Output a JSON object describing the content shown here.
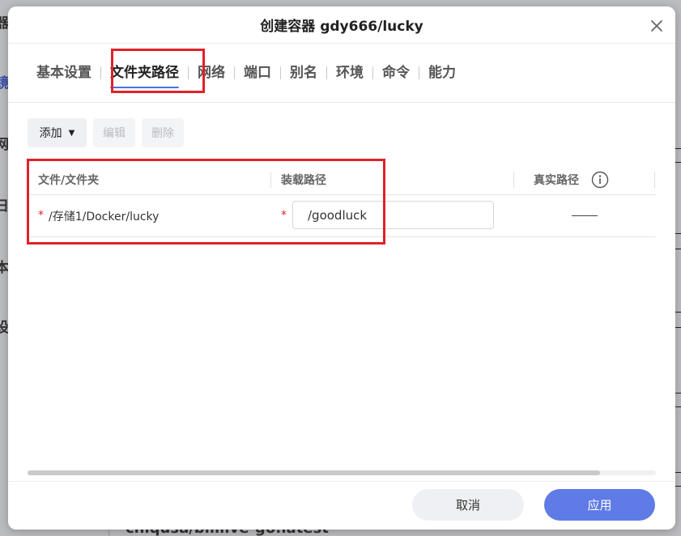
{
  "background": {
    "side_chars": [
      "器",
      "镜",
      "网",
      "日",
      "本",
      "设"
    ],
    "bottom_text": "chiqusa/bililive-go:latest"
  },
  "modal": {
    "title": "创建容器 gdy666/lucky",
    "close_icon": "close-icon"
  },
  "tabs": [
    {
      "label": "基本设置",
      "active": false
    },
    {
      "label": "文件夹路径",
      "active": true
    },
    {
      "label": "网络",
      "active": false
    },
    {
      "label": "端口",
      "active": false
    },
    {
      "label": "别名",
      "active": false
    },
    {
      "label": "环境",
      "active": false
    },
    {
      "label": "命令",
      "active": false
    },
    {
      "label": "能力",
      "active": false
    }
  ],
  "toolbar": {
    "add_label": "添加",
    "add_caret": "▼",
    "edit_label": "编辑",
    "delete_label": "删除"
  },
  "table": {
    "headers": {
      "file_folder": "文件/文件夹",
      "mount_path": "装载路径",
      "real_path": "真实路径"
    },
    "rows": [
      {
        "required_mark": "*",
        "file_folder": "/存储1/Docker/lucky",
        "mount_path": "/goodluck",
        "real_path": "——"
      }
    ]
  },
  "footer": {
    "cancel_label": "取消",
    "apply_label": "应用"
  },
  "colors": {
    "accent": "#5f7be6",
    "tab_underline": "#4c6ff0",
    "highlight": "#e0212a",
    "required": "#e0212a"
  }
}
